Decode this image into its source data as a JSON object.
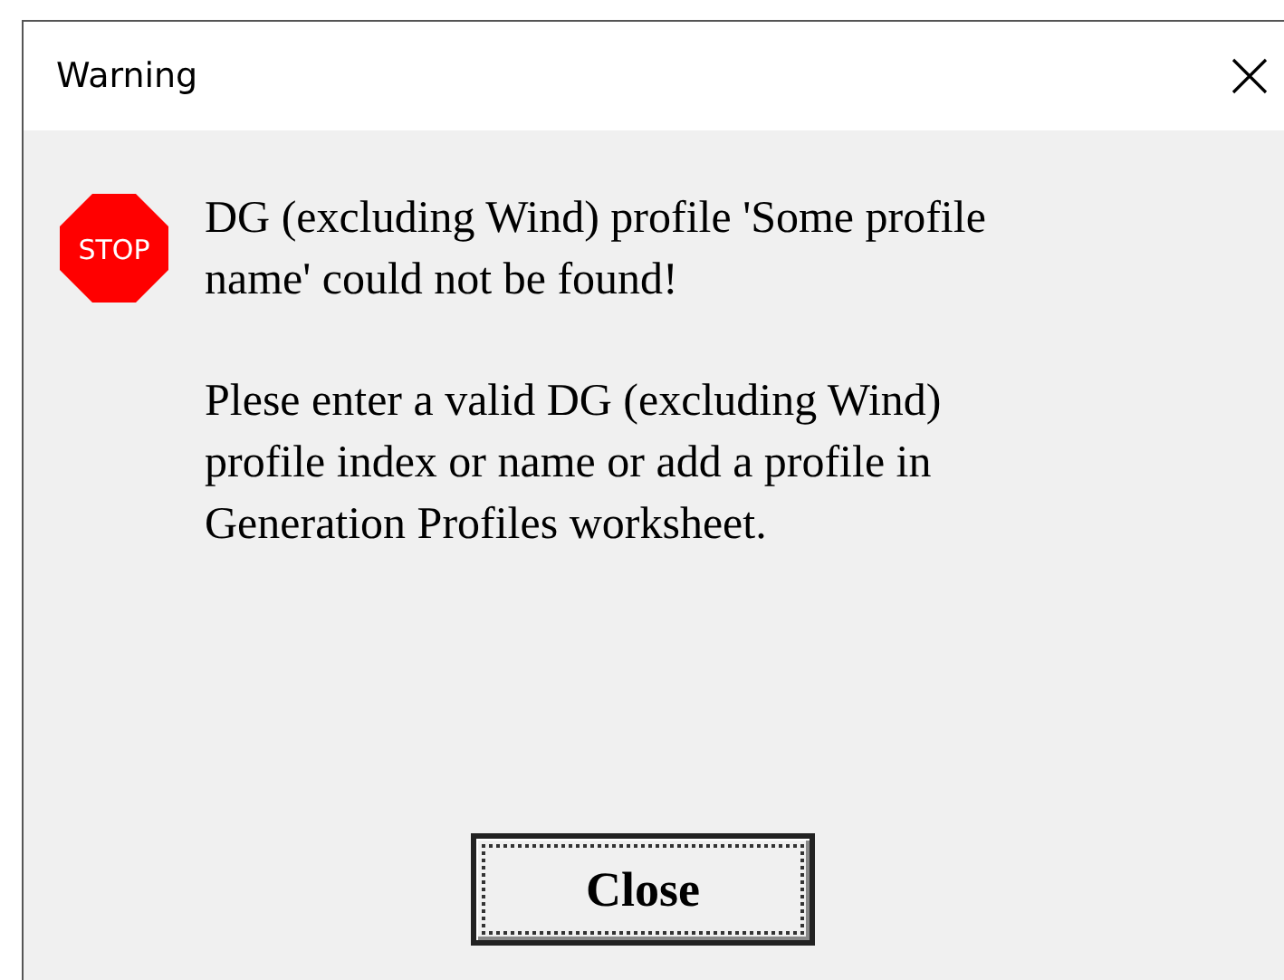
{
  "window": {
    "title": "Warning"
  },
  "icon": {
    "label": "STOP"
  },
  "message": {
    "paragraphs": [
      {
        "lines": [
          "DG (excluding Wind) profile 'Some profile",
          "name' could not be found!"
        ]
      },
      {
        "lines": [
          "Plese enter a valid DG (excluding Wind)",
          "profile index or name or add a profile in",
          "Generation Profiles worksheet."
        ]
      }
    ]
  },
  "buttons": [
    {
      "label": "Close",
      "focused": true
    }
  ]
}
